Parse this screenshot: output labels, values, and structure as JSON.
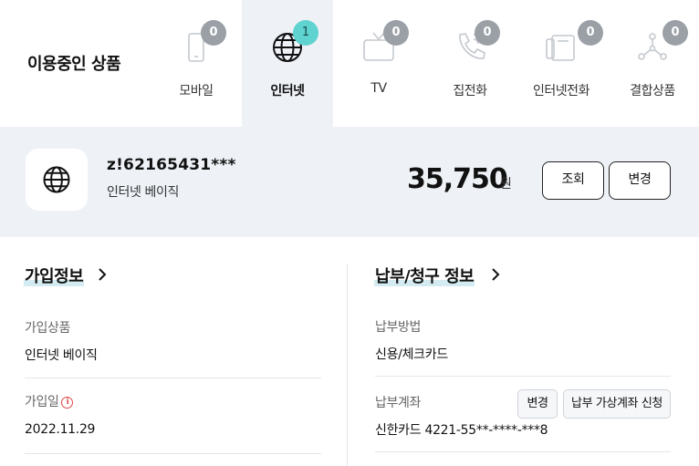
{
  "header": {
    "title": "이용중인 상품",
    "tabs": [
      {
        "label": "모바일",
        "count": "0",
        "icon": "mobile-icon",
        "active": false
      },
      {
        "label": "인터넷",
        "count": "1",
        "icon": "globe-icon",
        "active": true
      },
      {
        "label": "TV",
        "count": "0",
        "icon": "tv-icon",
        "active": false
      },
      {
        "label": "집전화",
        "count": "0",
        "icon": "phone-icon",
        "active": false
      },
      {
        "label": "인터넷전화",
        "count": "0",
        "icon": "internet-phone-icon",
        "active": false
      },
      {
        "label": "결합상품",
        "count": "0",
        "icon": "bundle-icon",
        "active": false
      }
    ]
  },
  "product": {
    "icon": "globe-icon",
    "id": "z!62165431***",
    "name": "인터넷 베이직",
    "price": "35,750",
    "currency": "원",
    "view_label": "조회",
    "change_label": "변경"
  },
  "subscription": {
    "title": "가입정보",
    "product_label": "가입상품",
    "product_value": "인터넷 베이직",
    "date_label": "가입일",
    "date_value": "2022.11.29"
  },
  "billing": {
    "title": "납부/청구 정보",
    "method_label": "납부방법",
    "method_value": "신용/체크카드",
    "account_label": "납부계좌",
    "account_value": "신한카드 4221-55**-****-***8",
    "change_label": "변경",
    "virtual_account_label": "납부 가상계좌 신청"
  },
  "colors": {
    "active_tab_bg": "#eef2f7",
    "badge_gray": "#9aa0a6",
    "badge_active": "#5fd3cf",
    "title_highlight": "#d4ecf1",
    "info_red": "#e04848"
  }
}
